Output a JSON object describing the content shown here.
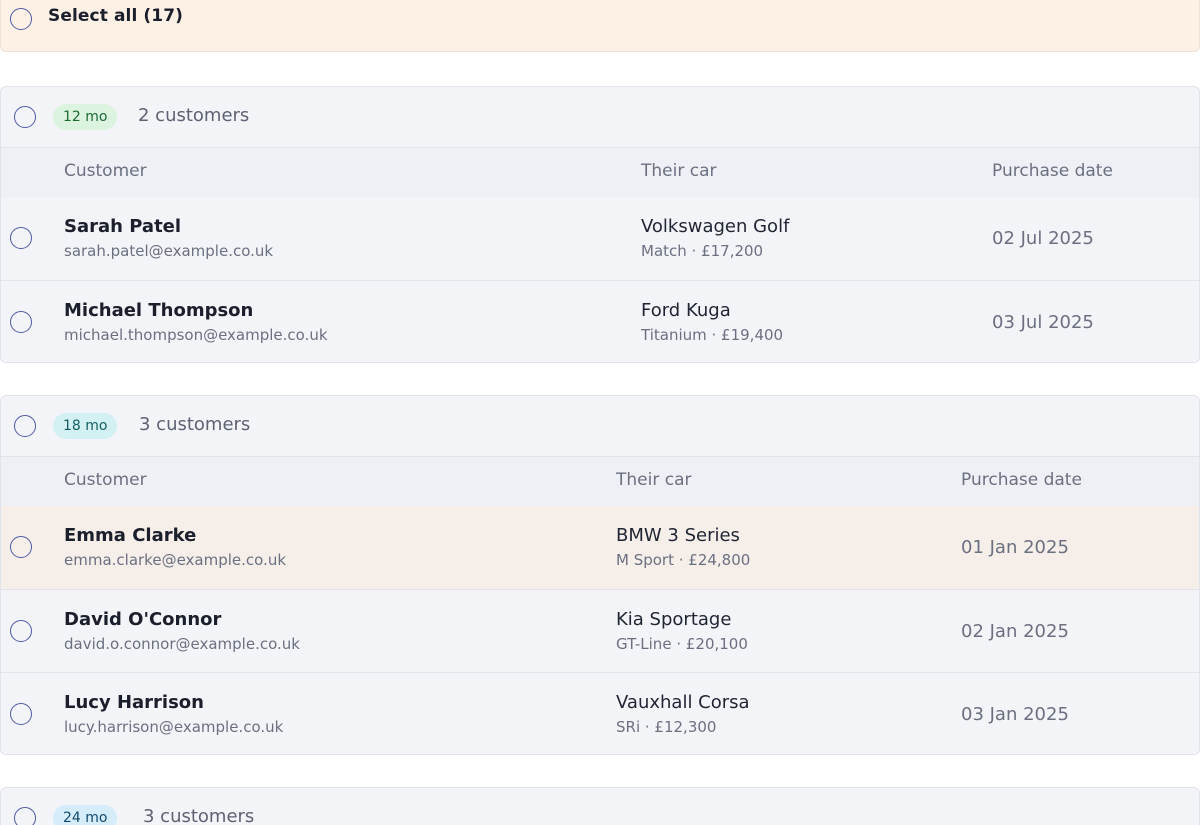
{
  "select_all": {
    "label": "Select all (17)"
  },
  "columns": {
    "customer": "Customer",
    "car": "Their car",
    "date": "Purchase date"
  },
  "groups": [
    {
      "badge": "12 mo",
      "count": "2 customers",
      "rows": [
        {
          "name": "Sarah Patel",
          "email": "sarah.patel@example.co.uk",
          "car": "Volkswagen Golf",
          "trim": "Match · £17,200",
          "date": "02 Jul 2025"
        },
        {
          "name": "Michael Thompson",
          "email": "michael.thompson@example.co.uk",
          "car": "Ford Kuga",
          "trim": "Titanium · £19,400",
          "date": "03 Jul 2025"
        }
      ]
    },
    {
      "badge": "18 mo",
      "count": "3 customers",
      "rows": [
        {
          "name": "Emma Clarke",
          "email": "emma.clarke@example.co.uk",
          "car": "BMW 3 Series",
          "trim": "M Sport · £24,800",
          "date": "01 Jan 2025"
        },
        {
          "name": "David O'Connor",
          "email": "david.o.connor@example.co.uk",
          "car": "Kia Sportage",
          "trim": "GT-Line · £20,100",
          "date": "02 Jan 2025"
        },
        {
          "name": "Lucy Harrison",
          "email": "lucy.harrison@example.co.uk",
          "car": "Vauxhall Corsa",
          "trim": "SRi · £12,300",
          "date": "03 Jan 2025"
        }
      ]
    },
    {
      "badge": "24 mo",
      "count": "3 customers",
      "rows": []
    }
  ],
  "colors": {
    "accent": "#4f59a8",
    "select_all_bg": "#fdf1e5",
    "badge_12": "#dcf3df",
    "badge_18": "#d3f1f2",
    "badge_24": "#d5ecfa",
    "highlight_row": "#f6efe9"
  }
}
